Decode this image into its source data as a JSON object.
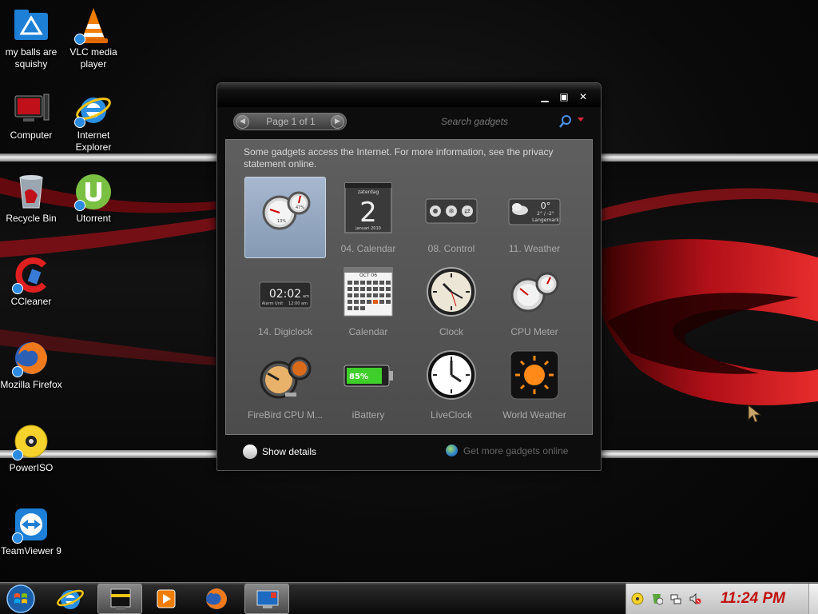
{
  "desktop": {
    "icons": [
      {
        "label": "my balls are squishy"
      },
      {
        "label": "VLC media player"
      },
      {
        "label": "Computer"
      },
      {
        "label": "Internet Explorer"
      },
      {
        "label": "Recycle Bin"
      },
      {
        "label": "Utorrent"
      },
      {
        "label": "CCleaner"
      },
      {
        "label": "Mozilla Firefox"
      },
      {
        "label": "PowerISO"
      },
      {
        "label": "TeamViewer 9"
      }
    ]
  },
  "gallery": {
    "pager_text": "Page 1 of 1",
    "search_placeholder": "Search gadgets",
    "notice": "Some gadgets access the Internet.  For more information, see the privacy statement online.",
    "gadgets": [
      {
        "label": "",
        "icon": "cpu-meter-icon"
      },
      {
        "label": "04. Calendar",
        "icon": "calendar-icon"
      },
      {
        "label": "08. Control",
        "icon": "control-icon"
      },
      {
        "label": "11. Weather",
        "icon": "weather-icon"
      },
      {
        "label": "14. Digiclock",
        "icon": "digiclock-icon"
      },
      {
        "label": "Calendar",
        "icon": "calendar-grid-icon"
      },
      {
        "label": "Clock",
        "icon": "clock-icon"
      },
      {
        "label": "CPU Meter",
        "icon": "cpu-meter-icon"
      },
      {
        "label": "FireBird CPU M...",
        "icon": "firebird-cpu-icon"
      },
      {
        "label": "iBattery",
        "icon": "battery-icon"
      },
      {
        "label": "LiveClock",
        "icon": "liveclock-icon"
      },
      {
        "label": "World Weather",
        "icon": "world-weather-icon"
      }
    ],
    "calendar_thumb": {
      "day_name": "zaterdag",
      "day": "2",
      "month_year": "januari 2010"
    },
    "calendar_grid_thumb": {
      "month": "OCT 06"
    },
    "weather_thumb": {
      "temp": "0°",
      "range": "2° / -2°",
      "place": "Langemark"
    },
    "digiclock_thumb": {
      "time": "02:02",
      "ampm": "am",
      "alarm": "Alarm Unit",
      "alarm_time": "12:00 am"
    },
    "battery_thumb": {
      "percent": "85%"
    },
    "cpu_thumb": {
      "a": "13%",
      "b": "47%"
    },
    "show_details": "Show details",
    "get_more": "Get more gadgets online"
  },
  "taskbar": {
    "clock": "11:24 PM"
  },
  "colors": {
    "accent_red": "#c01010",
    "selection": "#98abc3"
  }
}
